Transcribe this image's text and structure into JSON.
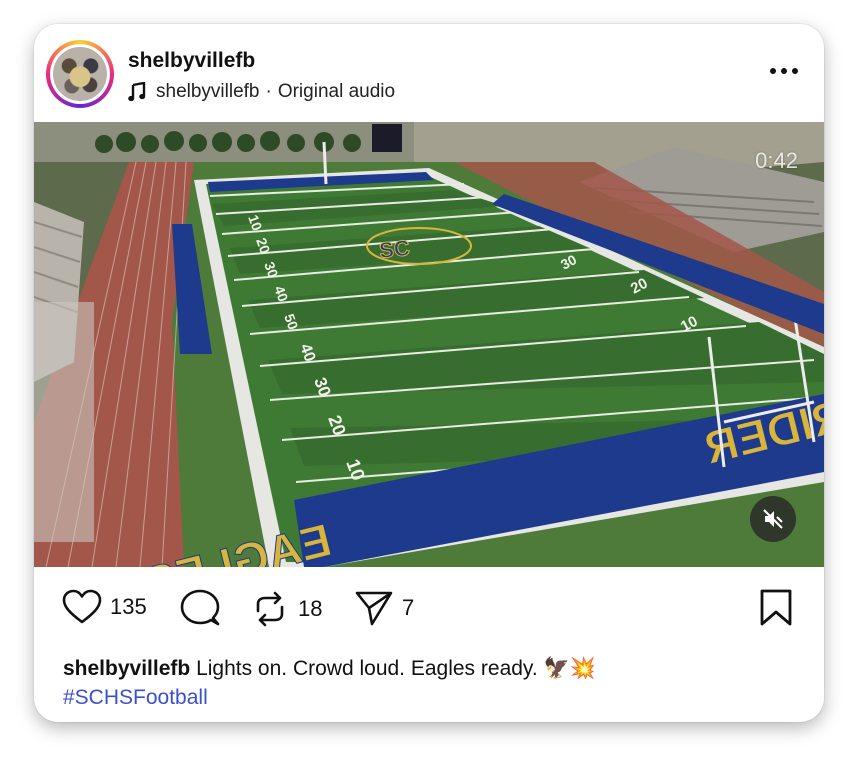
{
  "post": {
    "username": "shelbyvillefb",
    "audio_user": "shelbyvillefb",
    "audio_separator": "·",
    "audio_label": "Original audio",
    "video_timer": "0:42",
    "likes": "135",
    "reposts": "18",
    "shares": "7",
    "caption_user": "shelbyvillefb",
    "caption_text": "Lights on. Crowd loud. Eagles ready. 🦅💥",
    "hashtag": "#SCHSFootball"
  },
  "icons": {
    "music": "music-note-icon",
    "more": "more-horizontal-icon",
    "mute": "speaker-muted-icon",
    "like": "heart-icon",
    "comment": "comment-bubble-icon",
    "repost": "repost-arrows-icon",
    "share": "paper-plane-icon",
    "save": "bookmark-icon"
  },
  "colors": {
    "hashtag": "#3b4fd1",
    "field_green": "#3f7a34",
    "endzone_blue": "#1d3a8c",
    "endzone_text_gold": "#d9b53a"
  }
}
